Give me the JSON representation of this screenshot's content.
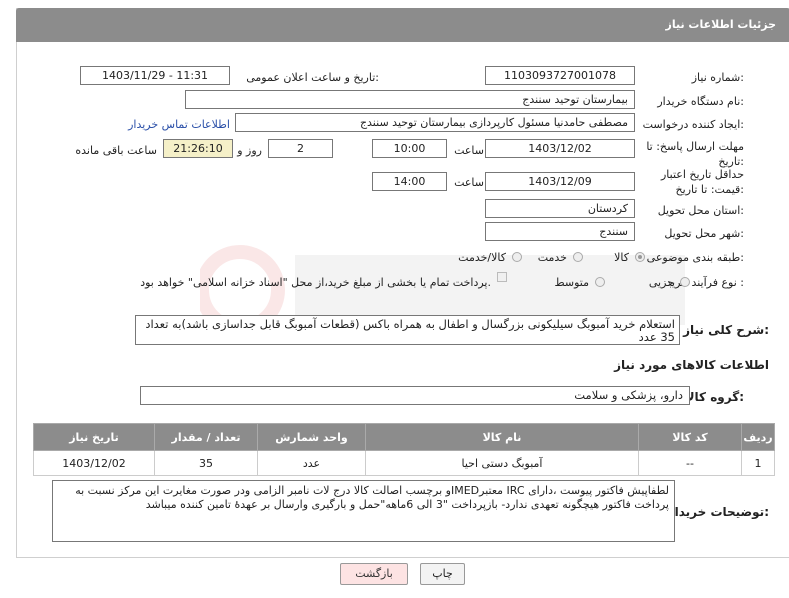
{
  "header": {
    "title": "جزئیات اطلاعات نیاز"
  },
  "labels": {
    "need_number": "شماره نیاز:",
    "announce_datetime": "تاریخ و ساعت اعلان عمومی:",
    "buyer_org": "نام دستگاه خریدار:",
    "creator": "ایجاد کننده درخواست:",
    "reply_deadline": "مهلت ارسال پاسخ: تا تاریخ:",
    "price_validity": "حداقل تاریخ اعتبار قیمت: تا تاریخ:",
    "province": "استان محل تحویل:",
    "city": "شهر محل تحویل:",
    "category": "طبقه بندی موضوعی:",
    "purchase_type": "نوع فرآیند خرید :",
    "hour1": "ساعت",
    "hour2": "ساعت",
    "day_and": "روز و",
    "hours_left": "ساعت باقی مانده",
    "general_desc": "شرح کلی نیاز:",
    "goods_info": "اطلاعات کالاهای مورد نیاز",
    "goods_group": "گروه کالا:",
    "buyer_notes": "توضیحات خریدار:"
  },
  "values": {
    "need_number": "1103093727001078",
    "announce_datetime": "1403/11/29 - 11:31",
    "buyer_org": "بیمارستان توحید سنندج",
    "creator": "مصطفی حامدنیا مسئول کارپردازی بیمارستان توحید سنندج",
    "contact_link": "اطلاعات تماس خریدار",
    "reply_date": "1403/12/02",
    "reply_time": "10:00",
    "days_left": "2",
    "time_left": "21:26:10",
    "validity_date": "1403/12/09",
    "validity_time": "14:00",
    "province": "کردستان",
    "city": "سنندج",
    "general_desc": "استعلام خرید آمبوبگ  سیلیکونی بزرگسال و اطفال به همراه باکس (قطعات آمبوبگ قابل جداسازی باشد)به تعداد 35 عدد",
    "goods_group": "دارو، پزشکی و سلامت",
    "buyer_notes": "لطفاپیش فاکتور پیوست ،دارای IRC معتبرIMEDو برچسب اصالت کالا درج لات نامبر الزامی ودر صورت مغایرت این مرکز نسبت به پرداخت فاکتور هیچگونه تعهدی ندارد- بازپرداخت \"3 الی 6ماهه\"حمل و بارگیری وارسال بر عهدهٔ تامین کننده میباشد"
  },
  "category_options": [
    {
      "label": "کالا",
      "selected": true
    },
    {
      "label": "خدمت",
      "selected": false
    },
    {
      "label": "کالا/خدمت",
      "selected": false
    }
  ],
  "purchase_options": [
    {
      "label": "جزیی",
      "selected": false
    },
    {
      "label": "متوسط",
      "selected": false
    }
  ],
  "treasury_note": "پرداخت تمام یا بخشی از مبلغ خرید،از محل \"اسناد خزانه اسلامی\" خواهد بود.",
  "table": {
    "headers": [
      "ردیف",
      "کد کالا",
      "نام کالا",
      "واحد شمارش",
      "تعداد / مقدار",
      "تاریخ نیاز"
    ],
    "rows": [
      [
        "1",
        "--",
        "آمبوبگ دستی احیا",
        "عدد",
        "35",
        "1403/12/02"
      ]
    ]
  },
  "buttons": {
    "print": "چاپ",
    "back": "بازگشت"
  },
  "colors": {
    "header_bg": "#8c8c8c",
    "date_box_bg": "#f5f0c8",
    "link": "#2a4fa8",
    "back_btn_bg": "#fde3e3"
  }
}
